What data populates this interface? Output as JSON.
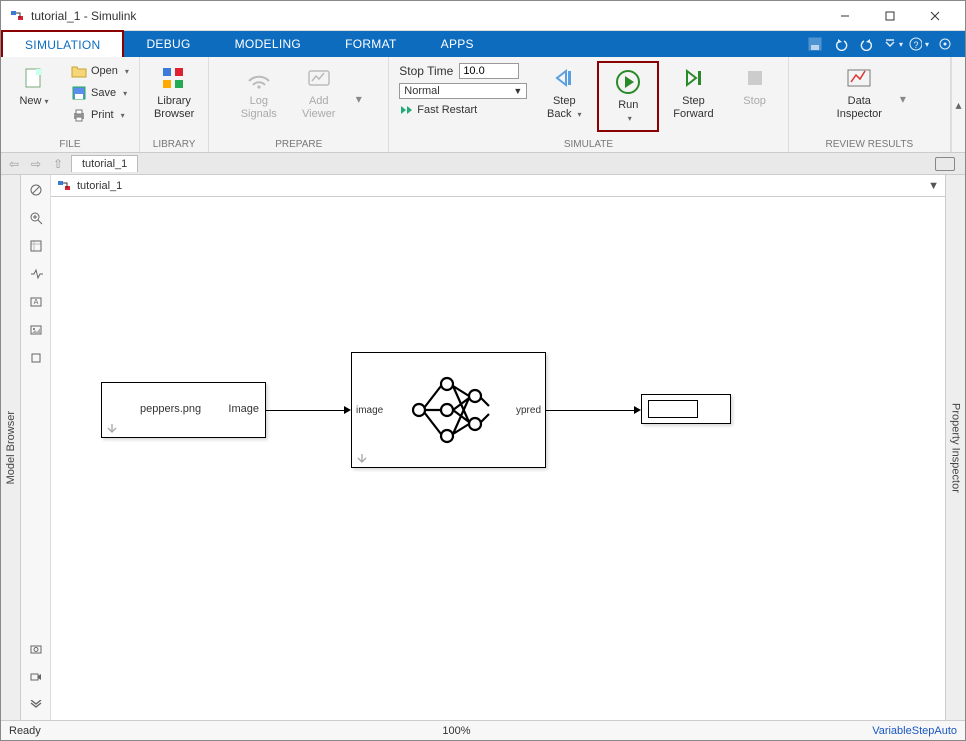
{
  "window": {
    "title": "tutorial_1 - Simulink"
  },
  "tabs": {
    "simulation": "SIMULATION",
    "debug": "DEBUG",
    "modeling": "MODELING",
    "format": "FORMAT",
    "apps": "APPS"
  },
  "ribbon": {
    "file": {
      "label": "FILE",
      "new": "New",
      "open": "Open",
      "save": "Save",
      "print": "Print"
    },
    "library": {
      "label": "LIBRARY",
      "browser": "Library\nBrowser"
    },
    "prepare": {
      "label": "PREPARE",
      "log": "Log\nSignals",
      "viewer": "Add\nViewer"
    },
    "simulate": {
      "label": "SIMULATE",
      "stoptime_label": "Stop Time",
      "stoptime_value": "10.0",
      "mode": "Normal",
      "fast": "Fast Restart",
      "stepback": "Step\nBack",
      "run": "Run",
      "stepfwd": "Step\nForward",
      "stop": "Stop"
    },
    "review": {
      "label": "REVIEW RESULTS",
      "di": "Data\nInspector"
    }
  },
  "doc": {
    "tab": "tutorial_1",
    "breadcrumb": "tutorial_1"
  },
  "sidepanels": {
    "left": "Model Browser",
    "right": "Property Inspector"
  },
  "blocks": {
    "src_file": "peppers.png",
    "src_port": "Image",
    "net_in": "image",
    "net_out": "ypred"
  },
  "status": {
    "ready": "Ready",
    "zoom": "100%",
    "solver": "VariableStepAuto"
  }
}
